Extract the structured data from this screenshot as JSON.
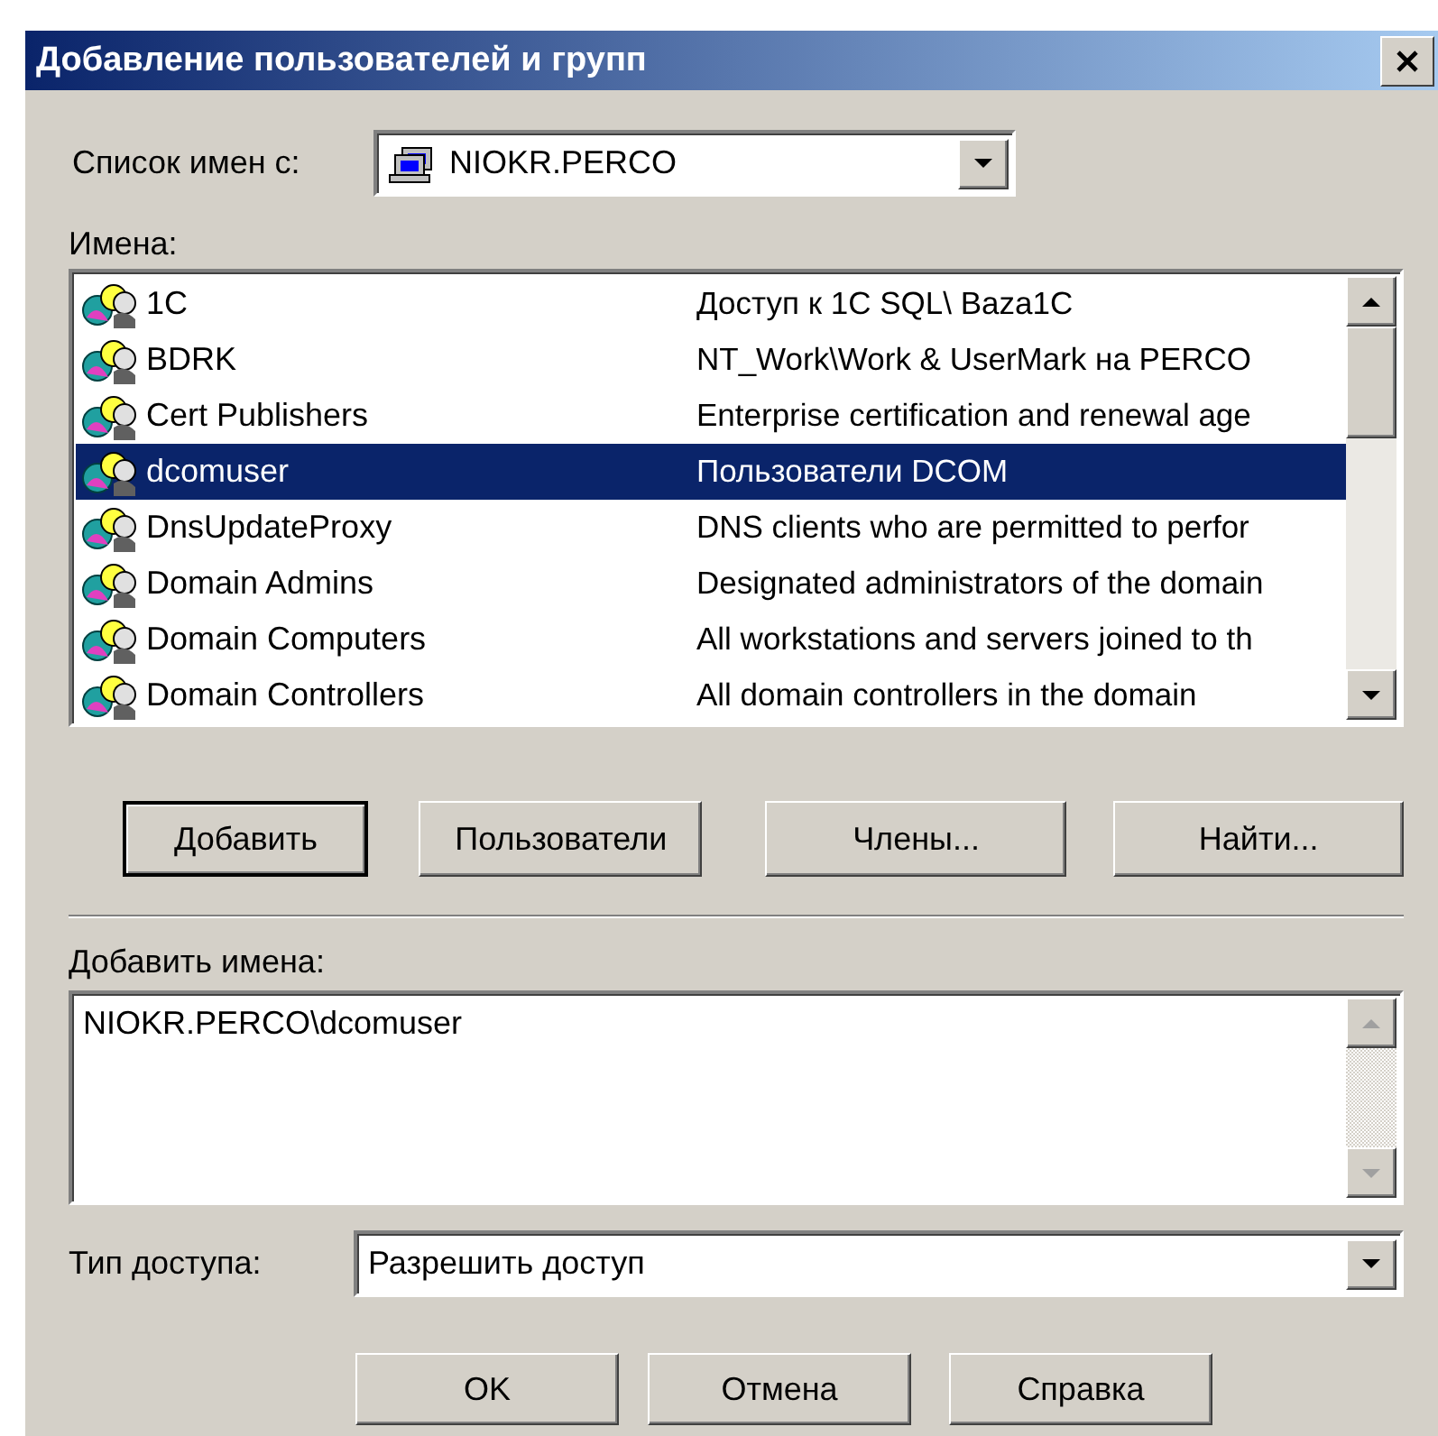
{
  "window": {
    "title": "Добавление пользователей и групп"
  },
  "list_from": {
    "label": "Список имен с:",
    "value": "NIOKR.PERCO"
  },
  "names": {
    "label": "Имена:",
    "rows": [
      {
        "name": "1C",
        "description": "Доступ к 1C SQL\\ Baza1C",
        "selected": false
      },
      {
        "name": "BDRK",
        "description": "NT_Work\\Work & UserMark на PERCO",
        "selected": false
      },
      {
        "name": "Cert Publishers",
        "description": "Enterprise certification and renewal age",
        "selected": false
      },
      {
        "name": "dcomuser",
        "description": "Пользователи DCOM",
        "selected": true
      },
      {
        "name": "DnsUpdateProxy",
        "description": "DNS clients who are permitted to perfor",
        "selected": false
      },
      {
        "name": "Domain Admins",
        "description": "Designated administrators of the domain",
        "selected": false
      },
      {
        "name": "Domain Computers",
        "description": "All workstations and servers joined to th",
        "selected": false
      },
      {
        "name": "Domain Controllers",
        "description": "All domain controllers in the domain",
        "selected": false
      }
    ]
  },
  "buttons": [
    {
      "label": "Добавить",
      "default": true
    },
    {
      "label": "Пользователи",
      "default": false
    },
    {
      "label": "Члены...",
      "default": false
    },
    {
      "label": "Найти...",
      "default": false
    }
  ],
  "add_names": {
    "label": "Добавить имена:",
    "value": "NIOKR.PERCO\\dcomuser"
  },
  "access_type": {
    "label": "Тип доступа:",
    "value": "Разрешить доступ"
  },
  "dialog_buttons": [
    "OK",
    "Отмена",
    "Справка"
  ]
}
